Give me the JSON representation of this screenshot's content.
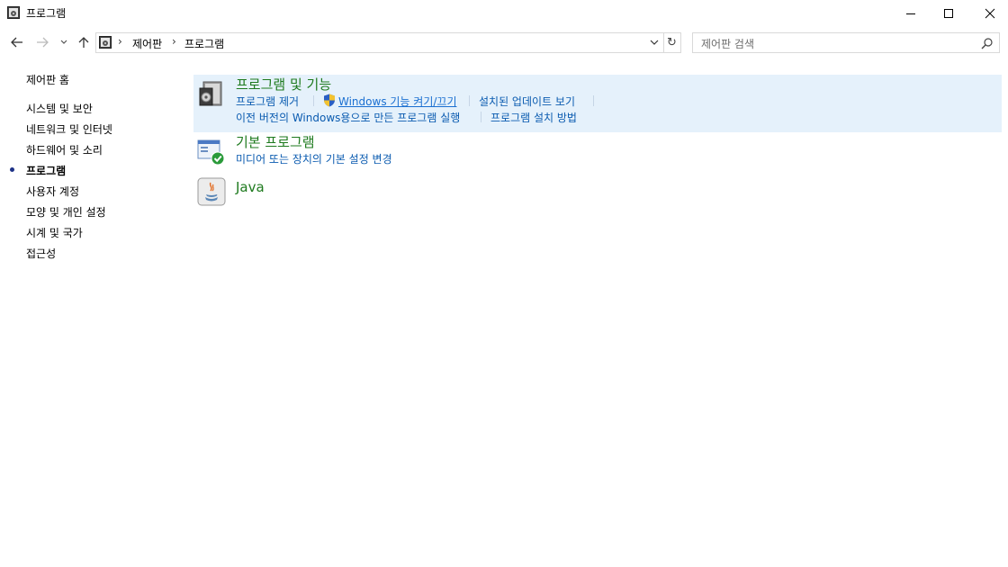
{
  "window": {
    "title": "프로그램"
  },
  "address": {
    "crumbs": [
      "제어판",
      "프로그램"
    ]
  },
  "search": {
    "placeholder": "제어판 검색"
  },
  "leftnav": {
    "items": [
      {
        "label": "제어판 홈"
      },
      {
        "label": "시스템 및 보안"
      },
      {
        "label": "네트워크 및 인터넷"
      },
      {
        "label": "하드웨어 및 소리"
      },
      {
        "label": "프로그램",
        "active": true
      },
      {
        "label": "사용자 계정"
      },
      {
        "label": "모양 및 개인 설정"
      },
      {
        "label": "시계 및 국가"
      },
      {
        "label": "접근성"
      }
    ]
  },
  "sections": [
    {
      "title": "프로그램 및 기능",
      "links": [
        "프로그램 제거",
        "Windows 기능 켜기/끄기",
        "설치된 업데이트 보기",
        "이전 버전의 Windows용으로 만든 프로그램 실행",
        "프로그램 설치 방법"
      ]
    },
    {
      "title": "기본 프로그램",
      "links": [
        "미디어 또는 장치의 기본 설정 변경"
      ]
    },
    {
      "title": "Java",
      "links": []
    }
  ],
  "colors": {
    "section_title": "#1e7a1e",
    "link": "#0a5bb0",
    "highlight": "#e5f1fb",
    "active_bullet": "#1e3287"
  }
}
